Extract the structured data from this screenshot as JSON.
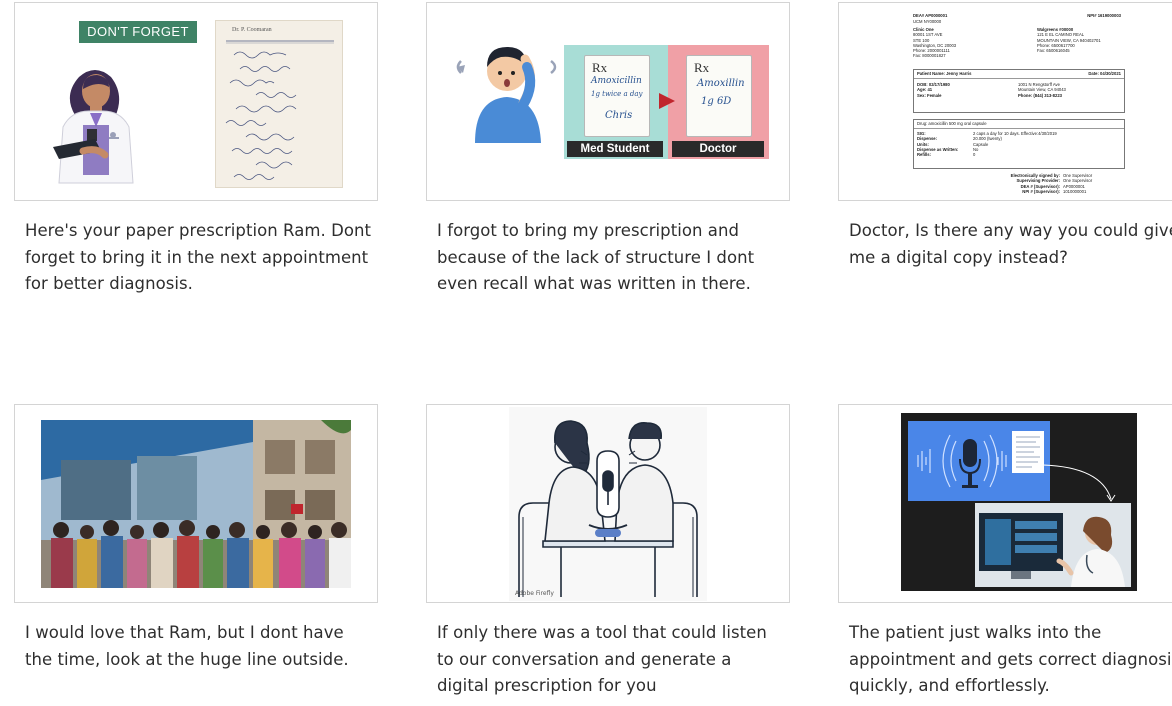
{
  "panels": [
    {
      "caption": "Here's your paper prescription Ram. Dont forget to bring it in the next appointment for better diagnosis.",
      "badge": "DON'T FORGET",
      "prescription_header": "Dr. P. Coomaran"
    },
    {
      "caption": "I forgot to bring my prescription and because of the lack of structure I dont even recall what was written in there.",
      "left_label": "Med Student",
      "right_label": "Doctor",
      "left_script": [
        "Amoxicillin",
        "1g twice a day",
        "Chris"
      ],
      "right_script": [
        "Amoxillin",
        "1g 6D"
      ],
      "rx_symbol": "Rx"
    },
    {
      "caption": "Doctor, Is there any way you could give me a digital copy instead?",
      "document": {
        "dea": "DEA# AP0000001",
        "npi": "NPI# 1619000003",
        "ucm": "UCM NY00000",
        "clinic": [
          "Clinic One",
          "80001 1ST AVE",
          "STE 100",
          "Washington, DC 20003",
          "Phone: 2000001111",
          "Fax: 8000001827"
        ],
        "pharmacy": [
          "Walgreens #00000",
          "121 E EL CAMINO REAL",
          "MOUNTAIN VIEW, CA 940402701",
          "Phone: 6500617700",
          "Fax: 6500616045"
        ],
        "patient": "Patient Name: Jenny Harris",
        "date": "Date: 04/30/2021",
        "details": [
          "DOB: 02/17/1980",
          "Age: 41",
          "Sex: Female"
        ],
        "address": [
          "1001 N Rengstorff Ave",
          "Mountain View, CA 94043",
          "Phone: (844) 313-8223"
        ],
        "drug": "Drug: amoxicillin 500 mg oral capsule",
        "rows": [
          [
            "SIG:",
            "2 caps a day for 10 days. Effective:4/30/2019"
          ],
          [
            "Dispense:",
            "20.000 (twenty)"
          ],
          [
            "Units:",
            "Capsule"
          ],
          [
            "Dispense as Written:",
            "No"
          ],
          [
            "Refills:",
            "0"
          ]
        ],
        "signed": [
          [
            "Electronically signed by:",
            "One Supervisor"
          ],
          [
            "Supervising Provider:",
            "One Supervisor"
          ],
          [
            "DEA # (Supervisor):",
            "AP0000001"
          ],
          [
            "NPI # (Supervisor):",
            "1010000001"
          ]
        ]
      }
    },
    {
      "caption": "I would love that Ram, but I dont have the time, look at the huge line outside."
    },
    {
      "caption": "If only there was a tool that could listen to our conversation and generate a digital prescription for you",
      "stamp": "Adobe Firefly"
    },
    {
      "caption": "The patient just walks into the appointment and gets correct diagnosis, quickly, and effortlessly."
    }
  ],
  "colors": {
    "badge": "#3f8366",
    "left_panel_bg": "#a8ddd6",
    "right_panel_bg": "#f0a0a6",
    "screen_blue": "#4a86e8",
    "border": "#d4d4d4"
  }
}
